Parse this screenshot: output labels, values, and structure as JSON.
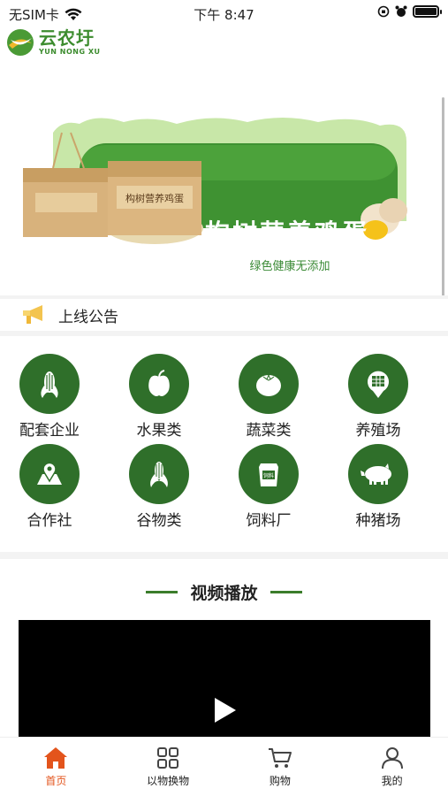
{
  "status_bar": {
    "carrier": "无SIM卡",
    "time": "下午 8:47"
  },
  "logo": {
    "name_cn": "云农圩",
    "name_en": "YUN NONG XU"
  },
  "banner": {
    "title": "构树营养鸡蛋",
    "subtitle": "绿色健康无添加",
    "box_label": "构树营养鸡蛋",
    "page_count": 1,
    "active_index": 0
  },
  "notice": {
    "text": "上线公告"
  },
  "categories": [
    {
      "label": "配套企业",
      "icon": "corn-icon"
    },
    {
      "label": "水果类",
      "icon": "apple-icon"
    },
    {
      "label": "蔬菜类",
      "icon": "tomato-icon"
    },
    {
      "label": "养殖场",
      "icon": "farm-map-icon"
    },
    {
      "label": "合作社",
      "icon": "location-icon"
    },
    {
      "label": "谷物类",
      "icon": "grain-icon"
    },
    {
      "label": "饲料厂",
      "icon": "feed-bag-icon"
    },
    {
      "label": "种猪场",
      "icon": "pig-icon"
    }
  ],
  "feed_bag_label": "饲料",
  "video_section": {
    "title": "视频播放"
  },
  "tabs": [
    {
      "label": "首页",
      "icon": "home-icon",
      "active": true
    },
    {
      "label": "以物换物",
      "icon": "grid-icon",
      "active": false
    },
    {
      "label": "购物",
      "icon": "cart-icon",
      "active": false
    },
    {
      "label": "我的",
      "icon": "user-icon",
      "active": false
    }
  ],
  "colors": {
    "brand_green": "#2f6f2a",
    "accent_green": "#3b7d2b",
    "tab_active": "#e3541c"
  }
}
